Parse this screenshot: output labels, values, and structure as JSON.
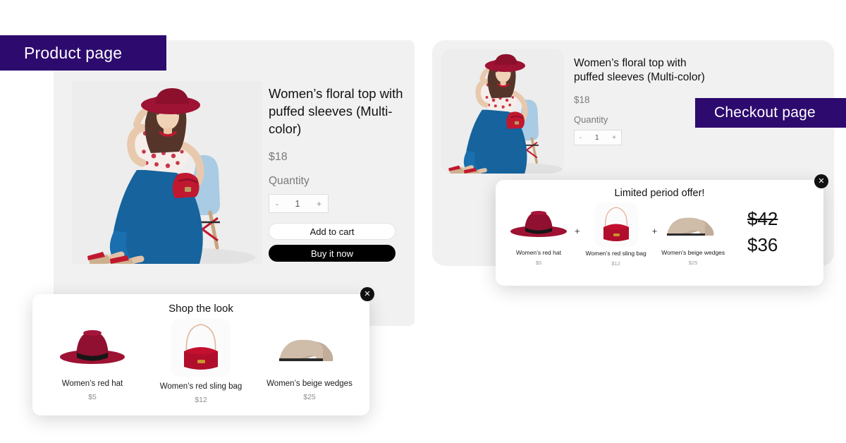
{
  "badges": {
    "product_page": "Product page",
    "checkout_page": "Checkout page",
    "color": "#2d0a6e"
  },
  "product": {
    "title": "Women’s floral top with puffed sleeves (Multi-color)",
    "price": "$18",
    "quantity_label": "Quantity",
    "quantity_value": "1",
    "decrement": "-",
    "increment": "+",
    "add_to_cart": "Add to cart",
    "buy_it_now": "Buy it now"
  },
  "checkout": {
    "title": "Women’s floral top with puffed sleeves (Multi-color)",
    "price": "$18",
    "quantity_label": "Quantity",
    "quantity_value": "1",
    "decrement": "-",
    "increment": "+"
  },
  "shop_popup": {
    "title": "Shop the look",
    "close": "✕",
    "items": [
      {
        "name": "Women’s red hat",
        "price": "$5",
        "icon": "red-hat-icon"
      },
      {
        "name": "Women’s red sling bag",
        "price": "$12",
        "icon": "red-sling-bag-icon"
      },
      {
        "name": "Women’s beige wedges",
        "price": "$25",
        "icon": "beige-wedges-icon"
      }
    ]
  },
  "offer_popup": {
    "title": "Limited period offer!",
    "close": "✕",
    "plus": "+",
    "items": [
      {
        "name": "Women’s red hat",
        "price": "$5",
        "icon": "red-hat-icon"
      },
      {
        "name": "Women’s red sling bag",
        "price": "$12",
        "icon": "red-sling-bag-icon"
      },
      {
        "name": "Women’s beige wedges",
        "price": "$25",
        "icon": "beige-wedges-icon"
      }
    ],
    "old_price": "$42",
    "new_price": "$36"
  },
  "colors": {
    "hat_red": "#9e1233",
    "bag_red": "#c3102f",
    "wedge_beige": "#c8b6a4",
    "skirt_blue": "#16639d",
    "chair_blue": "#a9cbe3",
    "badge_purple": "#2d0a6e",
    "card_gray": "#f1f1f1"
  }
}
